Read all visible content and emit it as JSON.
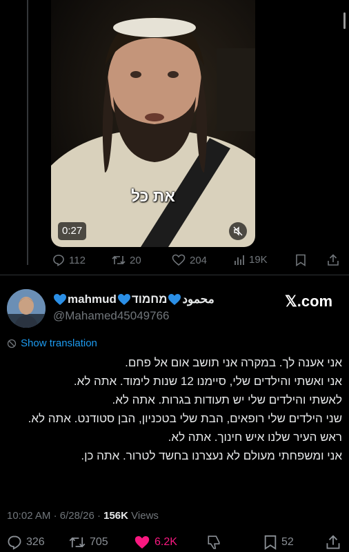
{
  "video": {
    "caption": "את כל",
    "duration": "0:27"
  },
  "parent_stats": {
    "replies": "112",
    "reposts": "20",
    "likes": "204",
    "views": "19K"
  },
  "tweet": {
    "display_name_arabic": "محمود",
    "display_name_latin": "mahmud",
    "display_name_hebrew": "מחמוד",
    "handle": "@Mahamed45049766",
    "watermark": "𝕏.com",
    "show_translation": "Show translation",
    "body_lines": [
      "אני אענה לך. במקרה אני תושב אום אל פחם.",
      "אני ואשתי והילדים שלי, סיימנו 12 שנות לימוד. אתה לא.",
      "לאשתי והילדים שלי יש תעודות בגרות. אתה לא.",
      "שני הילדים שלי רופאים, הבת שלי בטכניון, הבן סטודנט. אתה לא.",
      "ראש העיר שלנו איש חינוך. אתה לא.",
      "אני ומשפחתי מעולם לא נעצרנו בחשד לטרור. אתה כן."
    ],
    "time": "10:02 AM",
    "date": "6/28/26",
    "views_count": "156K",
    "views_label": "Views",
    "separator": "·"
  },
  "actions": {
    "replies": "326",
    "reposts": "705",
    "likes": "6.2K",
    "bookmarks": "52"
  },
  "colors": {
    "background": "#000000",
    "muted": "#71767b",
    "link": "#1d9bf0",
    "like": "#f91880",
    "heart_emoji": "#2b8fe6"
  }
}
